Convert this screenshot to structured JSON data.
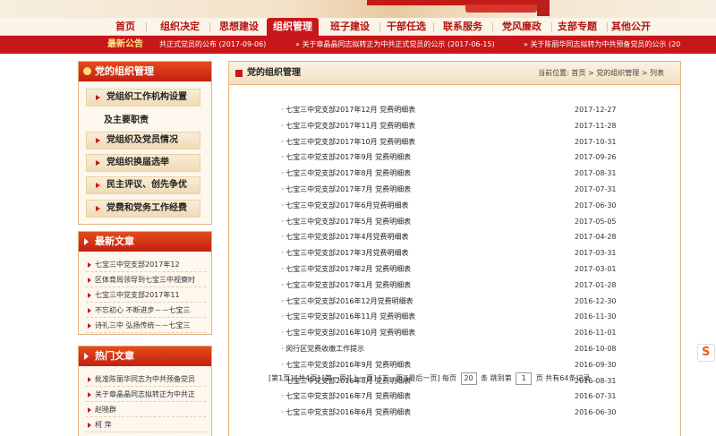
{
  "nav": [
    "首页",
    "组织决定",
    "思想建设",
    "组织管理",
    "班子建设",
    "干部任选",
    "联系服务",
    "党风廉政",
    "支部专题",
    "其他公开"
  ],
  "nav_active": 3,
  "announce": {
    "title": "最新公告",
    "items": [
      "共正式党员的公布 (2017-09-06)",
      "关于章晶晶同志拟转正为中共正式党员的公示 (2017-06-15)",
      "关于陈丽华同志拟转为中共预备党员的公示 (20"
    ]
  },
  "org_box": {
    "title": "党的组织管理",
    "items": [
      "党组织工作机构设置",
      "党组织及党员情况",
      "党组织换届选举",
      "民主评议、创先争优",
      "党费和党务工作经费"
    ],
    "item0_sub": "及主要职责"
  },
  "latest": {
    "title": "最新文章",
    "items": [
      "七宝三中党支部2017年12",
      "区体育局领导到七宝三中视察时",
      "七宝三中党支部2017年11",
      "不忘初心 不断进步－－七宝三",
      "诗礼三中 弘扬传统－－七宝三"
    ]
  },
  "hot": {
    "title": "热门文章",
    "items": [
      "批准陈丽华同志为中共预备党员",
      "关于章晶晶同志拟转正为中共正",
      "赵晓群",
      "柯 萍"
    ]
  },
  "main": {
    "title": "党的组织管理",
    "breadcrumb": "当前位置: 首页 > 党的组织管理 > 列表",
    "rows": [
      {
        "title": "七宝三中党支部2017年12月 党费明细表",
        "date": "2017-12-27"
      },
      {
        "title": "七宝三中党支部2017年11月 党费明细表",
        "date": "2017-11-28"
      },
      {
        "title": "七宝三中党支部2017年10月 党费明细表",
        "date": "2017-10-31"
      },
      {
        "title": "七宝三中党支部2017年9月 党费明细表",
        "date": "2017-09-26"
      },
      {
        "title": "七宝三中党支部2017年8月 党费明细表",
        "date": "2017-08-31"
      },
      {
        "title": "七宝三中党支部2017年7月 党费明细表",
        "date": "2017-07-31"
      },
      {
        "title": "七宝三中党支部2017年6月党费明细表",
        "date": "2017-06-30"
      },
      {
        "title": "七宝三中党支部2017年5月 党费明细表",
        "date": "2017-05-05"
      },
      {
        "title": "七宝三中党支部2017年4月党费明细表",
        "date": "2017-04-28"
      },
      {
        "title": "七宝三中党支部2017年3月党费明细表",
        "date": "2017-03-31"
      },
      {
        "title": "七宝三中党支部2017年2月 党费明细表",
        "date": "2017-03-01"
      },
      {
        "title": "七宝三中党支部2017年1月 党费明细表",
        "date": "2017-01-28"
      },
      {
        "title": "七宝三中党支部2016年12月党费明细表",
        "date": "2016-12-30"
      },
      {
        "title": "七宝三中党支部2016年11月 党费明细表",
        "date": "2016-11-30"
      },
      {
        "title": "七宝三中党支部2016年10月 党费明细表",
        "date": "2016-11-01"
      },
      {
        "title": "闵行区党费收缴工作提示",
        "date": "2016-10-08"
      },
      {
        "title": "七宝三中党支部2016年9月 党费明细表",
        "date": "2016-09-30"
      },
      {
        "title": "七宝三中党支部2016年8月 党费明细表",
        "date": "2016-08-31"
      },
      {
        "title": "七宝三中党支部2016年7月 党费明细表",
        "date": "2016-07-31"
      },
      {
        "title": "七宝三中党支部2016年6月 党费明细表",
        "date": "2016-06-30"
      }
    ]
  },
  "pager": {
    "first": "[第1页]",
    "total_pages": "/[共4页]",
    "first_page": "[第一页]",
    "prev": "[上一页]",
    "next": "[下一页]",
    "last": "[最后一页]",
    "per_page_label": "每页",
    "per_page": "20",
    "per_page_unit": "条",
    "jump_label": "跳到第",
    "jump_value": "1",
    "jump_unit": "页",
    "total": "共有64条记录"
  },
  "float_icon": "S"
}
